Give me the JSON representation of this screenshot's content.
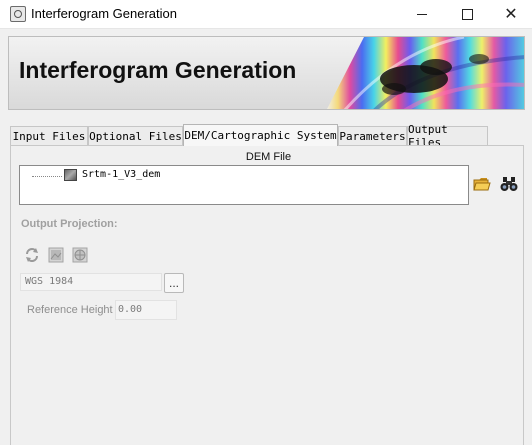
{
  "window": {
    "title": "Interferogram Generation",
    "controls": [
      "minimize-icon",
      "maximize-icon",
      "close-icon"
    ]
  },
  "banner": {
    "title": "Interferogram Generation"
  },
  "tabs": [
    {
      "label": "Input Files",
      "active": false
    },
    {
      "label": "Optional Files",
      "active": false
    },
    {
      "label": "DEM/Cartographic System",
      "active": true
    },
    {
      "label": "Parameters",
      "active": false
    },
    {
      "label": "Output Files",
      "active": false
    }
  ],
  "dem": {
    "label": "DEM File",
    "items": [
      {
        "name": "Srtm-1_V3_dem",
        "icon": "raster-icon"
      }
    ],
    "buttons": [
      "folder-open-icon",
      "binoculars-icon"
    ]
  },
  "projection": {
    "label": "Output Projection:",
    "toolbar": [
      "refresh-icon",
      "raster-projection-icon",
      "globe-projection-icon"
    ],
    "value": "WGS 1984",
    "browse_label": "...",
    "reference_height_label": "Reference Height",
    "reference_height_value": "0.00"
  },
  "colors": {
    "window_bg": "#f0f0f0",
    "disabled_text": "#a0a0a0",
    "border": "#8a8a8a"
  }
}
